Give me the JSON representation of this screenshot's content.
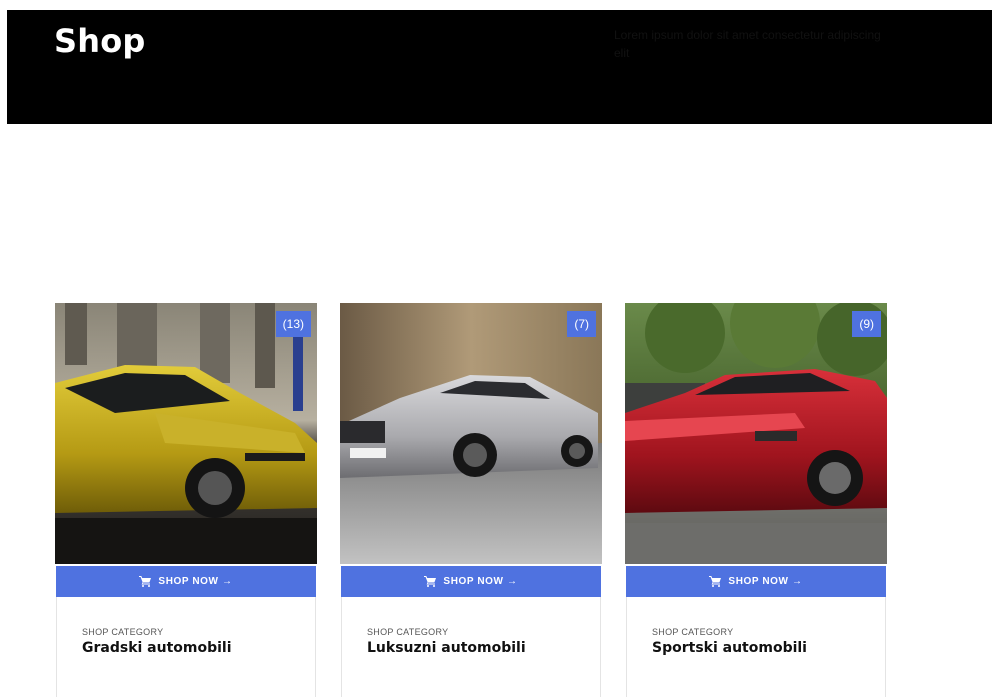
{
  "page": {
    "title": "Shop",
    "description": "Lorem ipsum dolor sit amet consectetur adipiscing elit"
  },
  "cards": [
    {
      "count": "(13)",
      "button_label": "SHOP NOW →",
      "category_label": "SHOP CATEGORY",
      "name": "Gradski automobili",
      "image": "yellow-hatchback-car"
    },
    {
      "count": "(7)",
      "button_label": "SHOP NOW →",
      "category_label": "SHOP CATEGORY",
      "name": "Luksuzni automobili",
      "image": "silver-luxury-sedan"
    },
    {
      "count": "(9)",
      "button_label": "SHOP NOW →",
      "category_label": "SHOP CATEGORY",
      "name": "Sportski automobili",
      "image": "red-sports-car"
    }
  ],
  "colors": {
    "accent": "#4f72e0",
    "hero_background": "#000000"
  },
  "icons": {
    "cart": "shopping-cart-icon"
  }
}
